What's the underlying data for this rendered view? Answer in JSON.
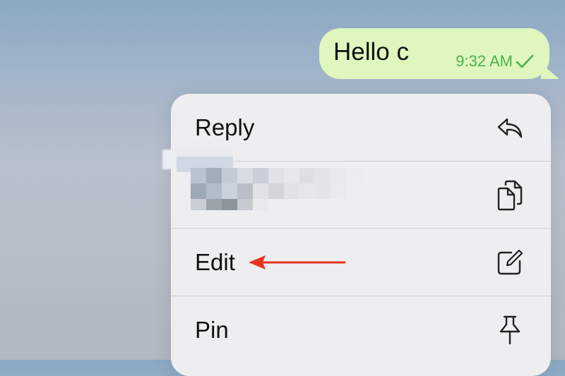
{
  "message": {
    "text": "Hello c",
    "time": "9:32 AM",
    "status_icon": "check-icon",
    "bubble_color": "#dff7bf",
    "meta_color": "#4cb050"
  },
  "menu": {
    "items": [
      {
        "label": "Reply",
        "icon": "reply-icon"
      },
      {
        "label": "",
        "icon": "copy-icon",
        "redacted": true
      },
      {
        "label": "Edit",
        "icon": "edit-icon"
      },
      {
        "label": "Pin",
        "icon": "pin-icon"
      }
    ]
  },
  "annotation": {
    "arrow_color": "#e8321e",
    "points_to": "Edit"
  }
}
